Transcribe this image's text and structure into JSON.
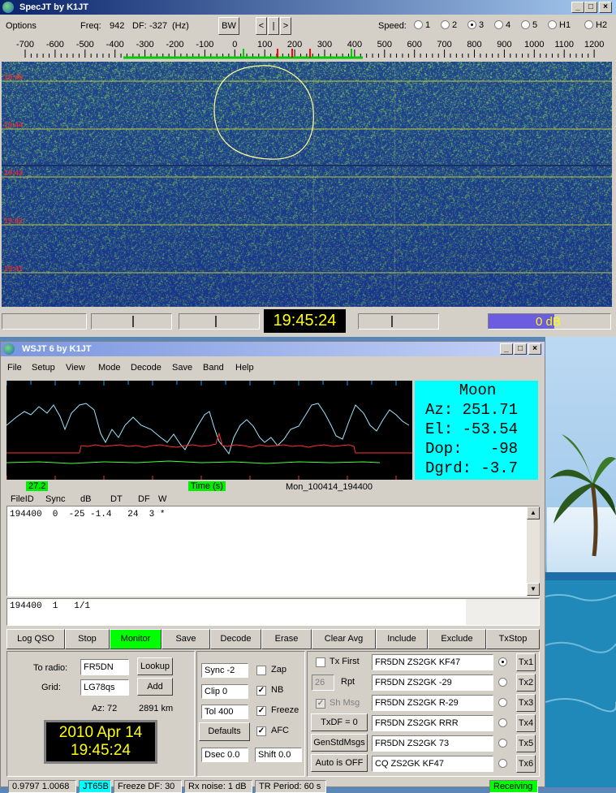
{
  "spec": {
    "title": "SpecJT    by K1JT",
    "menu": "Options",
    "freq_label": "Freq:",
    "freq": "942",
    "df_label": "DF:",
    "df": "-327",
    "df_unit": "(Hz)",
    "bw": "BW",
    "nav": [
      "<",
      "|",
      ">"
    ],
    "speed_label": "Speed:",
    "speeds": [
      "1",
      "2",
      "3",
      "4",
      "5",
      "H1",
      "H2"
    ],
    "speed_selected": "3",
    "scale": [
      "-700",
      "-600",
      "-500",
      "-400",
      "-300",
      "-200",
      "-100",
      "0",
      "100",
      "200",
      "300",
      "400",
      "500",
      "600",
      "700",
      "800",
      "900",
      "1000",
      "1100",
      "1200"
    ],
    "timestamps": [
      "19:45",
      "19:44",
      "19:43",
      "19:42",
      "19:41"
    ],
    "time": "19:45:24",
    "gain": "0 dB"
  },
  "wsjt": {
    "title": "WSJT 6    by K1JT",
    "menu": [
      "File",
      "Setup",
      "View",
      "Mode",
      "Decode",
      "Save",
      "Band",
      "Help"
    ],
    "moon": {
      "title": "Moon",
      "az": "Az: 251.71",
      "el": "El: -53.54",
      "dop": "Dop:   -98",
      "dgrd": "Dgrd: -3.7"
    },
    "graph_val": "27.2",
    "graph_xlabel": "Time (s)",
    "file_label": "Mon_100414_194400",
    "columns": [
      "FileID",
      "Sync",
      "dB",
      "DT",
      "DF",
      "W"
    ],
    "decoded": "194400  0  -25 -1.4   24  3 *",
    "avg": "194400  1   1/1",
    "buttons": [
      "Log QSO",
      "Stop",
      "Monitor",
      "Save",
      "Decode",
      "Erase",
      "Clear Avg",
      "Include",
      "Exclude",
      "TxStop"
    ],
    "to_radio_label": "To radio:",
    "to_radio": "FR5DN",
    "lookup": "Lookup",
    "grid_label": "Grid:",
    "grid": "LG78qs",
    "add": "Add",
    "az": "Az: 72",
    "dist": "2891 km",
    "date": "2010 Apr 14",
    "clock": "19:45:24",
    "sync": "Sync  -2",
    "clip": "Clip  0",
    "tol": "Tol   400",
    "defaults": "Defaults",
    "dsec": "Dsec  0.0",
    "shift": "Shift 0.0",
    "zap": "Zap",
    "nb": "NB",
    "freeze": "Freeze",
    "afc": "AFC",
    "tx_first": "Tx First",
    "rpt_val": "26",
    "rpt": "Rpt",
    "sh_msg": "Sh Msg",
    "txdf": "TxDF = 0",
    "genstd": "GenStdMsgs",
    "auto": "Auto is OFF",
    "tx_msgs": [
      "FR5DN ZS2GK KF47",
      "FR5DN ZS2GK -29",
      "FR5DN ZS2GK R-29",
      "FR5DN ZS2GK RRR",
      "FR5DN ZS2GK 73",
      "CQ ZS2GK KF47"
    ],
    "tx_labels": [
      "Tx1",
      "Tx2",
      "Tx3",
      "Tx4",
      "Tx5",
      "Tx6"
    ],
    "status": [
      "0.9797 1.0068",
      "JT65B",
      "Freeze DF:  30",
      "Rx noise:  1 dB",
      "TR Period: 60 s",
      "Receiving"
    ]
  },
  "colors": {
    "title_bar": "#0a246a",
    "monitor": "#00ff00",
    "moon_bg": "#00ffff",
    "waterfall": "#2a5296"
  }
}
